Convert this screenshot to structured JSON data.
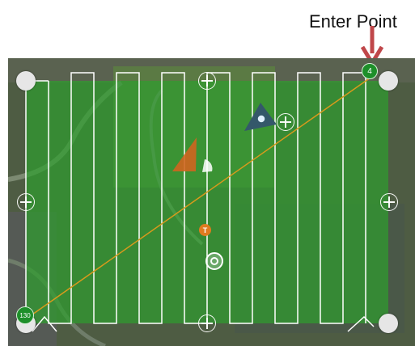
{
  "annotation": {
    "label": "Enter Point"
  },
  "waypoints": {
    "start_label": "4",
    "end_label": "130"
  },
  "markers": {
    "home_label": "T"
  },
  "icons": {
    "arrow": "down-arrow-icon",
    "corner_handle": "circle-handle-icon",
    "edge_handle": "plus-circle-icon",
    "aircraft": "drone-icon",
    "center": "target-icon",
    "camera_view": "camera-direction-icon"
  },
  "colors": {
    "survey_area_fill": "#2e9e2e",
    "flight_line": "#ffffff",
    "course_line": "#d89a1c",
    "callout_arrow": "#c0474a",
    "waypoint_badge": "#1e8f2a",
    "aircraft": "#d0651f",
    "home_marker": "#e07b1f"
  }
}
